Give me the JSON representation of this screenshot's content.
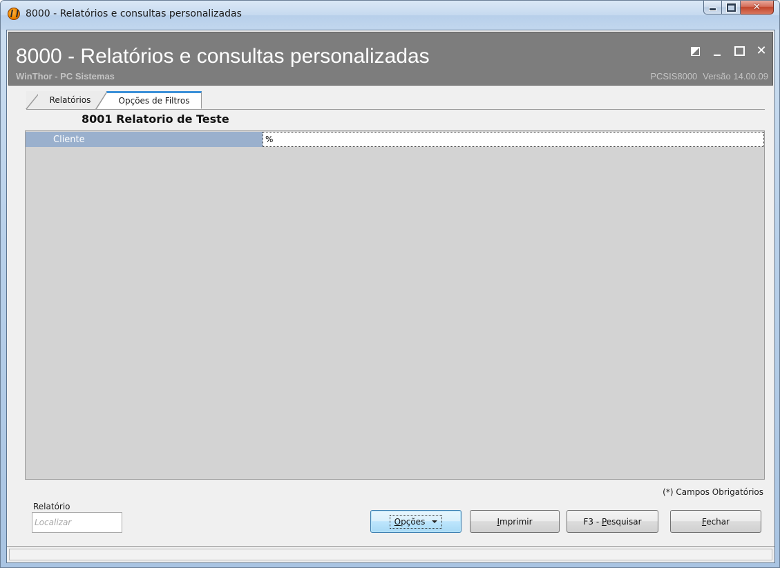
{
  "window": {
    "title": "8000 - Relatórios e consultas personalizadas",
    "minimize_icon": "minimize-icon",
    "maximize_icon": "maximize-icon",
    "close_icon": "close-icon",
    "close_glyph": "✕"
  },
  "header": {
    "title": "8000 - Relatórios e consultas personalizadas",
    "subtitle": "WinThor - PC Sistemas",
    "program_code": "PCSIS8000",
    "version": "Versão 14.00.09",
    "background_color": "#7d7d7d"
  },
  "tabs": [
    {
      "label": "Relatórios",
      "active": false
    },
    {
      "label": "Opções de Filtros",
      "active": true
    }
  ],
  "report": {
    "title": "8001 Relatorio de Teste"
  },
  "filters": [
    {
      "label": "Cliente",
      "value": "%"
    }
  ],
  "required_note": "(*) Campos Obrigatórios",
  "search": {
    "label": "Relatório",
    "placeholder": "Localizar"
  },
  "buttons": {
    "opcoes_pre": "",
    "opcoes_ul": "O",
    "opcoes_post": "pções",
    "imprimir_ul": "I",
    "imprimir_post": "mprimir",
    "pesquisar_pre": "F3 - ",
    "pesquisar_ul": "P",
    "pesquisar_post": "esquisar",
    "fechar_ul": "F",
    "fechar_post": "echar"
  },
  "colors": {
    "grid_label_bg": "#9ab0cd",
    "grid_bg": "#d3d3d3",
    "active_tab_accent": "#3a8fd8"
  }
}
